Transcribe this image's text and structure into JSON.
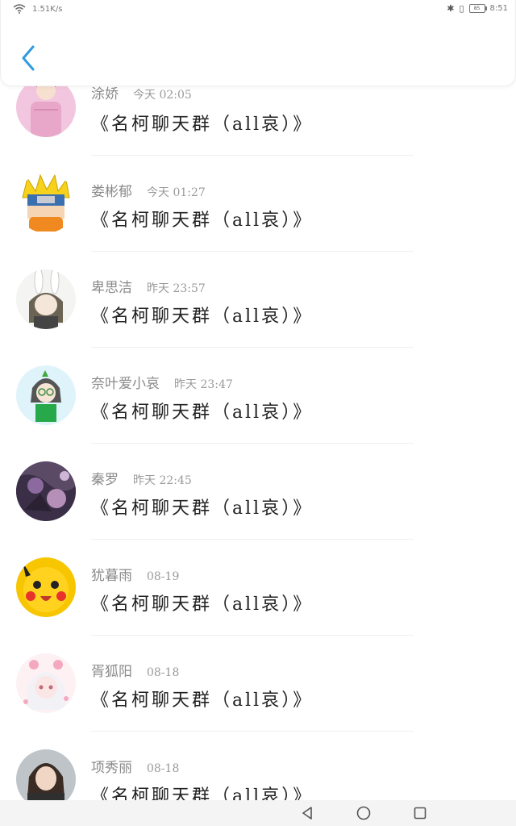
{
  "status": {
    "speed": "1.51K/s",
    "time": "8:51",
    "battery": "85"
  },
  "messages": [
    {
      "name": "涂娇",
      "time": "今天 02:05",
      "text": "《名柯聊天群（all哀）》"
    },
    {
      "name": "娄彬郁",
      "time": "今天 01:27",
      "text": "《名柯聊天群（all哀）》"
    },
    {
      "name": "卑思洁",
      "time": "昨天 23:57",
      "text": "《名柯聊天群（all哀）》"
    },
    {
      "name": "奈叶爱小哀",
      "time": "昨天 23:47",
      "text": "《名柯聊天群（all哀）》"
    },
    {
      "name": "秦罗",
      "time": "昨天 22:45",
      "text": "《名柯聊天群（all哀）》"
    },
    {
      "name": "犹暮雨",
      "time": "08-19",
      "text": "《名柯聊天群（all哀）》"
    },
    {
      "name": "胥狐阳",
      "time": "08-18",
      "text": "《名柯聊天群（all哀）》"
    },
    {
      "name": "项秀丽",
      "time": "08-18",
      "text": "《名柯聊天群（all哀）》"
    }
  ],
  "icons": {
    "back": "chevron-left-icon",
    "nav_back": "triangle-back-icon",
    "nav_home": "circle-home-icon",
    "nav_recent": "square-recent-icon"
  },
  "colors": {
    "accent": "#2f9be0",
    "name_gray": "#8a8a8a",
    "message_text": "#222222"
  }
}
